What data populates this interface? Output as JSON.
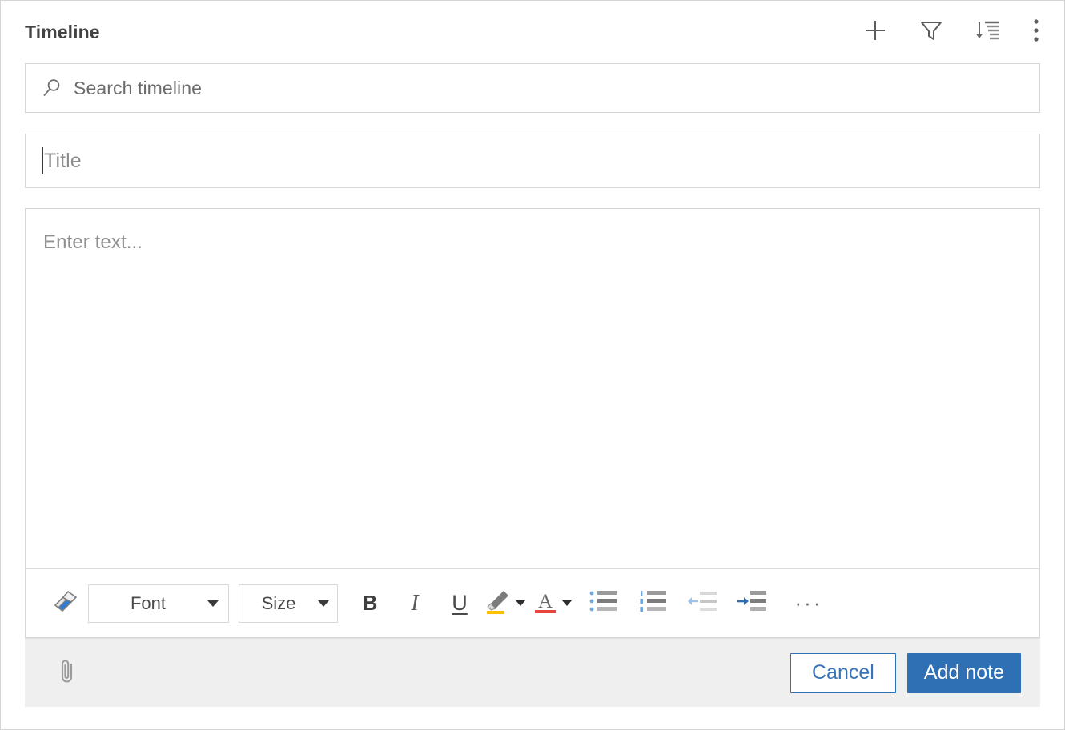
{
  "header": {
    "title": "Timeline",
    "actions": [
      {
        "name": "add-icon",
        "label": "Add"
      },
      {
        "name": "filter-icon",
        "label": "Filter"
      },
      {
        "name": "sort-icon",
        "label": "Sort"
      },
      {
        "name": "more-options-icon",
        "label": "More options"
      }
    ]
  },
  "search": {
    "placeholder": "Search timeline",
    "value": "",
    "icon": "search-icon"
  },
  "note_form": {
    "title_placeholder": "Title",
    "title_value": "",
    "body_placeholder": "Enter text...",
    "body_value": ""
  },
  "toolbar": {
    "format_painter": "format-painter-icon",
    "font_label": "Font",
    "size_label": "Size",
    "bold_label": "B",
    "italic_label": "I",
    "underline_label": "U",
    "highlight": "highlight-icon",
    "font_color": "font-color-icon",
    "bullet_list": "bullet-list-icon",
    "numbered_list": "numbered-list-icon",
    "decrease_indent": "decrease-indent-icon",
    "increase_indent": "increase-indent-icon",
    "more_label": "···"
  },
  "footer": {
    "attach": "attachment-icon",
    "cancel_label": "Cancel",
    "submit_label": "Add note"
  },
  "colors": {
    "accent": "#2f6fb4",
    "border": "#d6d6d6",
    "footer_bg": "#efefef",
    "placeholder": "#8d8d8d",
    "highlight_yellow": "#ffc000",
    "font_color_red": "#e8453c"
  }
}
